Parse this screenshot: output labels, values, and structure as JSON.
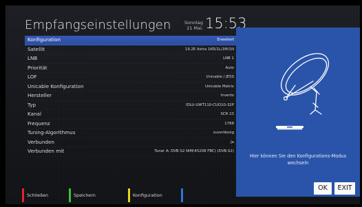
{
  "header": {
    "title": "Empfangseinstellungen",
    "weekday": "Sonntag",
    "date": "21 Mai.",
    "time": "15:53"
  },
  "settings": [
    {
      "label": "Konfiguration",
      "value": "Erweitert",
      "selected": true
    },
    {
      "label": "Satellit",
      "value": "19.2E Astra 1KR/1L/1M/1N"
    },
    {
      "label": "LNB",
      "value": "LNB 1"
    },
    {
      "label": "Priorität",
      "value": "Auto"
    },
    {
      "label": "LOF",
      "value": "Unicable / JESS"
    },
    {
      "label": "Unicable Konfiguration",
      "value": "Unicable Matrix"
    },
    {
      "label": "Hersteller",
      "value": "Inverto"
    },
    {
      "label": "Typ",
      "value": "IDLU-UWT110-CUO10-32P"
    },
    {
      "label": "Kanal",
      "value": "SCR 23"
    },
    {
      "label": "Frequenz",
      "value": "1788"
    },
    {
      "label": "Tuning-Algorithmus",
      "value": "zuverlässig"
    },
    {
      "label": "Verbunden",
      "value": "Ja"
    },
    {
      "label": "Verbunden mit",
      "value": "Tuner A: DVB-S2 NIM(45208 FBC) (DVB-S2)"
    }
  ],
  "panel": {
    "help_text": "Hier können Sie den Konfigurations-Modus wechseln",
    "ok_label": "OK",
    "exit_label": "EXIT",
    "illustration_icon": "satellite-dish-icon",
    "receiver_icon": "receiver-box-icon"
  },
  "footer": [
    {
      "label": "Schließen",
      "color": "#e0262b"
    },
    {
      "label": "Speichern",
      "color": "#3cc23a"
    },
    {
      "label": "Konfiguration",
      "color": "#e8d51e"
    },
    {
      "label": "",
      "color": "#2b78e4"
    }
  ],
  "colors": {
    "selection": "#3559b3",
    "panel": "#2a54a9",
    "background": "#15171b"
  }
}
